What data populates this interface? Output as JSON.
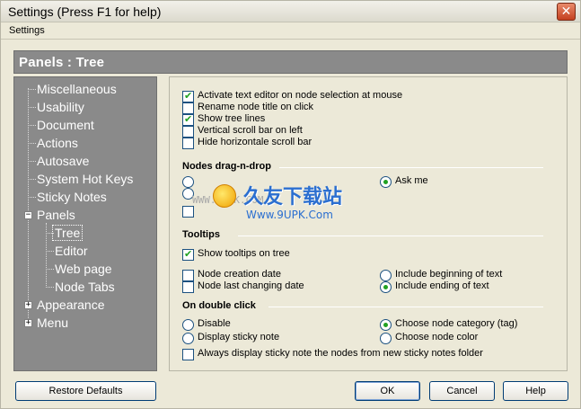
{
  "window": {
    "title": "Settings (Press F1 for help)",
    "close_glyph": "✕"
  },
  "menubar": {
    "items": [
      "Settings"
    ]
  },
  "header": {
    "title": "Panels : Tree"
  },
  "tree": {
    "items": [
      {
        "label": "Miscellaneous"
      },
      {
        "label": "Usability"
      },
      {
        "label": "Document"
      },
      {
        "label": "Actions"
      },
      {
        "label": "Autosave"
      },
      {
        "label": "System Hot Keys"
      },
      {
        "label": "Sticky Notes"
      },
      {
        "label": "Panels",
        "expander": "−"
      },
      {
        "label": "Tree",
        "selected": true
      },
      {
        "label": "Editor"
      },
      {
        "label": "Web page"
      },
      {
        "label": "Node Tabs"
      },
      {
        "label": "Appearance",
        "expander": "+"
      },
      {
        "label": "Menu",
        "expander": "+"
      }
    ]
  },
  "general_options": [
    {
      "label": "Activate text editor on node selection at mouse",
      "checked": true
    },
    {
      "label": "Rename node title on click",
      "checked": false
    },
    {
      "label": "Show tree lines",
      "checked": true
    },
    {
      "label": "Vertical scroll bar on left",
      "checked": false
    },
    {
      "label": "Hide horizontale scroll bar",
      "checked": false
    }
  ],
  "drag_drop": {
    "title": "Nodes drag-n-drop",
    "ask_me_label": "Ask me",
    "ask_me_selected": true
  },
  "tooltips": {
    "title": "Tooltips",
    "show_tooltips": {
      "label": "Show tooltips on tree",
      "checked": true
    },
    "node_creation_date": {
      "label": "Node creation date",
      "checked": false
    },
    "node_last_changing_date": {
      "label": "Node last changing date",
      "checked": false
    },
    "include_beginning": {
      "label": "Include beginning of text",
      "selected": false
    },
    "include_ending": {
      "label": "Include ending of text",
      "selected": true
    }
  },
  "double_click": {
    "title": "On double click",
    "disable": {
      "label": "Disable",
      "selected": false
    },
    "display_sticky": {
      "label": "Display sticky note",
      "selected": false
    },
    "choose_category": {
      "label": "Choose node category (tag)",
      "selected": true
    },
    "choose_color": {
      "label": "Choose node color",
      "selected": false
    },
    "always_display": {
      "label": "Always display sticky note the nodes from new sticky notes folder",
      "checked": false
    }
  },
  "watermark": {
    "left_text": "WWW.9UPK.COM",
    "big_text": "久友下载站",
    "small_text": "Www.9UPK.Com"
  },
  "buttons": {
    "restore_defaults": "Restore Defaults",
    "ok": "OK",
    "cancel": "Cancel",
    "help": "Help"
  },
  "check_glyph": "✔"
}
